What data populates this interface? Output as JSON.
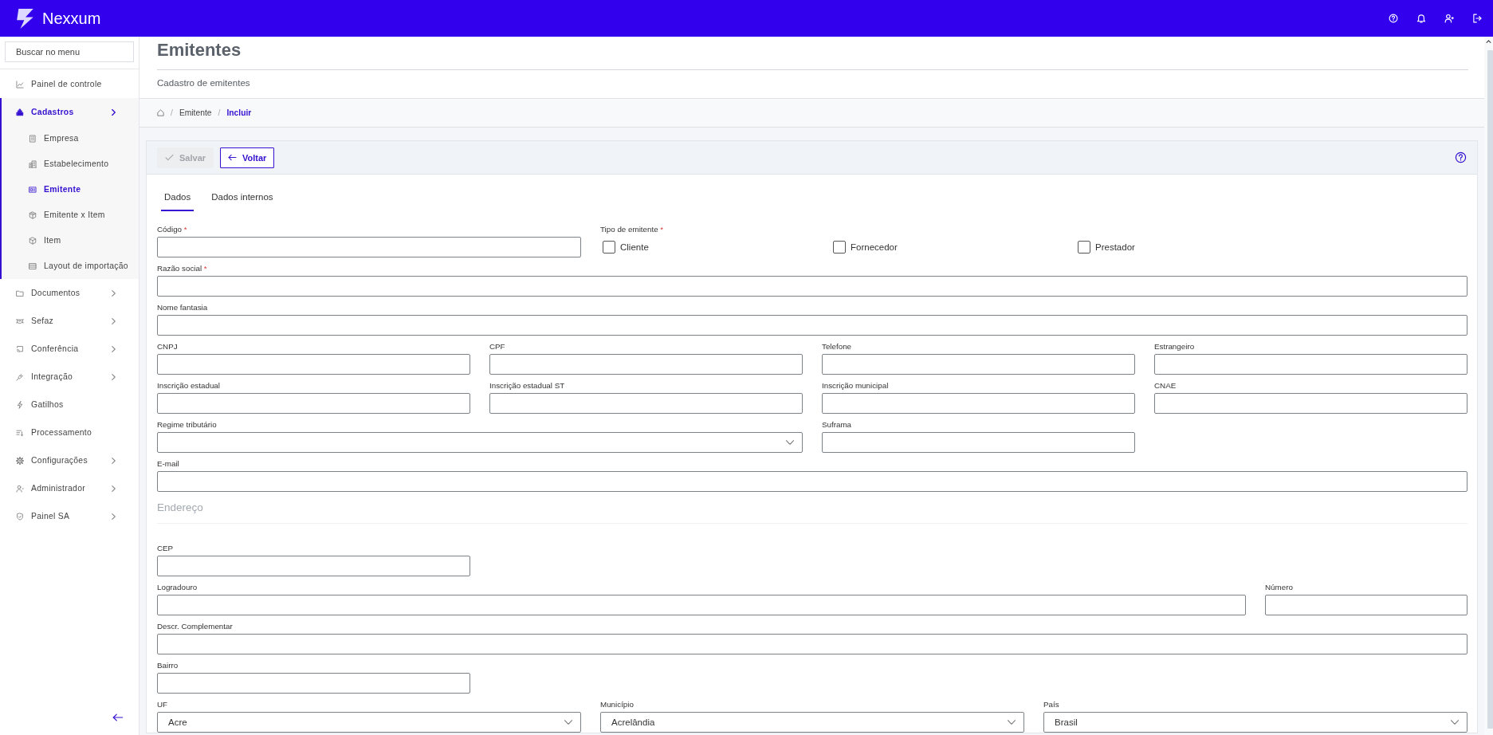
{
  "topbar": {
    "app_name": "Nexxum"
  },
  "sidebar": {
    "search": {
      "placeholder": "Buscar no menu"
    },
    "items": [
      {
        "label": "Painel de controle",
        "selected": false,
        "expandable": false
      },
      {
        "label": "Cadastros",
        "selected": true,
        "expandable": true,
        "children": [
          {
            "label": "Empresa",
            "selected": false
          },
          {
            "label": "Estabelecimento",
            "selected": false
          },
          {
            "label": "Emitente",
            "selected": true
          },
          {
            "label": "Emitente x Item",
            "selected": false
          },
          {
            "label": "Item",
            "selected": false
          },
          {
            "label": "Layout de importação",
            "selected": false
          }
        ]
      },
      {
        "label": "Documentos",
        "selected": false,
        "expandable": true
      },
      {
        "label": "Sefaz",
        "selected": false,
        "expandable": true
      },
      {
        "label": "Conferência",
        "selected": false,
        "expandable": true
      },
      {
        "label": "Integração",
        "selected": false,
        "expandable": true
      },
      {
        "label": "Gatilhos",
        "selected": false,
        "expandable": false
      },
      {
        "label": "Processamento",
        "selected": false,
        "expandable": false
      },
      {
        "label": "Configurações",
        "selected": false,
        "expandable": true
      },
      {
        "label": "Administrador",
        "selected": false,
        "expandable": true
      },
      {
        "label": "Painel SA",
        "selected": false,
        "expandable": true
      }
    ]
  },
  "page_header": {
    "title": "Emitentes",
    "subtitle": "Cadastro de emitentes"
  },
  "breadcrumb": [
    {
      "separator": "/",
      "label": "Emitente",
      "current": false
    },
    {
      "separator": "/",
      "label": "Incluir",
      "current": true
    }
  ],
  "toolbar": {
    "buttons": [
      {
        "label": "Salvar",
        "disabled": true
      },
      {
        "label": "Voltar",
        "disabled": false
      }
    ]
  },
  "tabs": [
    {
      "label": "Dados",
      "selected": true
    },
    {
      "label": "Dados internos",
      "selected": false
    }
  ],
  "form": {
    "fields": [
      {
        "kind": "text",
        "label": "Código",
        "required_mark": "*"
      },
      {
        "kind": "checkboxes",
        "label": "Tipo de emitente",
        "required_mark": "*",
        "options": [
          {
            "label": "Cliente",
            "checked": false
          },
          {
            "label": "Fornecedor",
            "checked": false
          },
          {
            "label": "Prestador",
            "checked": false
          }
        ]
      },
      {
        "kind": "text",
        "label": "Razão social",
        "required_mark": "*"
      },
      {
        "kind": "text",
        "label": "Nome fantasia"
      },
      {
        "kind": "text",
        "label": "CNPJ"
      },
      {
        "kind": "text",
        "label": "CPF"
      },
      {
        "kind": "text",
        "label": "Telefone"
      },
      {
        "kind": "text",
        "label": "Estrangeiro"
      },
      {
        "kind": "text",
        "label": "Inscrição estadual"
      },
      {
        "kind": "text",
        "label": "Inscrição estadual ST"
      },
      {
        "kind": "text",
        "label": "Inscrição municipal"
      },
      {
        "kind": "text",
        "label": "CNAE"
      },
      {
        "kind": "select",
        "label": "Regime tributário"
      },
      {
        "kind": "text",
        "label": "Suframa"
      },
      {
        "kind": "text",
        "label": "E-mail"
      }
    ]
  },
  "address": {
    "title": "Endereço",
    "fields": [
      {
        "kind": "text",
        "label": "CEP"
      },
      {
        "kind": "text",
        "label": "Logradouro"
      },
      {
        "kind": "text",
        "label": "Número"
      },
      {
        "kind": "text",
        "label": "Descr. Complementar"
      },
      {
        "kind": "text",
        "label": "Bairro"
      },
      {
        "kind": "select",
        "label": "UF",
        "value": "Acre"
      },
      {
        "kind": "select",
        "label": "Município",
        "value": "Acrelândia"
      },
      {
        "kind": "select",
        "label": "País",
        "value": "Brasil"
      }
    ]
  }
}
